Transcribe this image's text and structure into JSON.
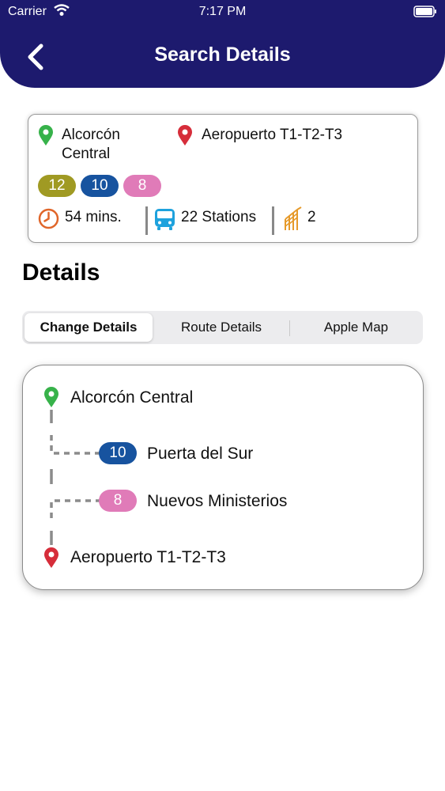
{
  "status_bar": {
    "carrier": "Carrier",
    "time": "7:17 PM"
  },
  "header": {
    "title": "Search Details",
    "back_icon": "chevron-left-icon"
  },
  "summary": {
    "origin": {
      "line1": "Alcorcón",
      "line2": "Central"
    },
    "destination": "Aeropuerto T1-T2-T3",
    "lines": [
      {
        "label": "12",
        "color": "#a09a23"
      },
      {
        "label": "10",
        "color": "#17539f"
      },
      {
        "label": "8",
        "color": "#e07bb8"
      }
    ],
    "duration": "54 mins.",
    "stations": "22 Stations",
    "changes": "2"
  },
  "details": {
    "title": "Details",
    "tabs": [
      {
        "label": "Change Details",
        "active": true
      },
      {
        "label": "Route Details",
        "active": false
      },
      {
        "label": "Apple Map",
        "active": false
      }
    ]
  },
  "route": {
    "start": "Alcorcón Central",
    "changes": [
      {
        "line": "10",
        "color": "#17539f",
        "station": "Puerta del Sur"
      },
      {
        "line": "8",
        "color": "#e07bb8",
        "station": "Nuevos Ministerios"
      }
    ],
    "end": "Aeropuerto T1-T2-T3"
  },
  "colors": {
    "header": "#1d1a6e",
    "origin_pin": "#37b24a",
    "destination_pin": "#d62d3a",
    "clock": "#e0662a",
    "bus": "#1ea2dd",
    "stairs": "#e69a2a"
  }
}
